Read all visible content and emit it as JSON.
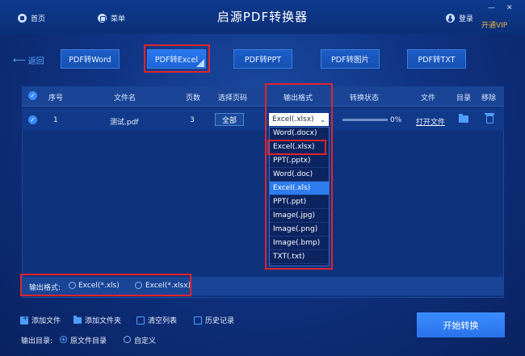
{
  "titlebar": {
    "home_label": "首页",
    "menu_label": "菜单",
    "app_title": "启源PDF转换器",
    "login_label": "登录",
    "vip_label": "开通VIP"
  },
  "nav": {
    "back_label": "返回",
    "tabs": [
      {
        "label": "PDF转Word"
      },
      {
        "label": "PDF转Excel",
        "active": true
      },
      {
        "label": "PDF转PPT"
      },
      {
        "label": "PDF转图片"
      },
      {
        "label": "PDF转TXT"
      }
    ]
  },
  "table": {
    "headers": {
      "index": "序号",
      "filename": "文件名",
      "pages": "页数",
      "select_pages": "选择页码",
      "output_format": "输出格式",
      "status": "转换状态",
      "file": "文件",
      "directory": "目录",
      "remove": "移除"
    },
    "rows": [
      {
        "index": "1",
        "filename": "测试.pdf",
        "pages": "3",
        "page_select": "全部",
        "format": "Excel(.xlsx)",
        "progress": 0,
        "progress_text": "0%",
        "open_file": "打开文件"
      }
    ]
  },
  "dropdown": {
    "options": [
      "Word(.docx)",
      "Excel(.xlsx)",
      "PPT(.pptx)",
      "Word(.doc)",
      "Excel(.xls)",
      "PPT(.ppt)",
      "Image(.jpg)",
      "Image(.png)",
      "Image(.bmp)",
      "TXT(.txt)"
    ],
    "highlighted": "Excel(.xls)",
    "selected": "Excel(.xlsx)"
  },
  "format_bar": {
    "label": "输出格式:",
    "options": [
      "Excel(*.xls)",
      "Excel(*.xlsx)"
    ]
  },
  "toolbar": {
    "add_file": "添加文件",
    "add_folder": "添加文件夹",
    "clear_list": "清空列表",
    "history": "历史记录"
  },
  "output_dir": {
    "label": "输出目录:",
    "original": "原文件目录",
    "custom": "自定义"
  },
  "start_button": "开始转换",
  "colors": {
    "background": "#0f3282",
    "accent": "#2a73ea",
    "highlight_box": "#e0242b",
    "vip": "#f0b43a"
  }
}
